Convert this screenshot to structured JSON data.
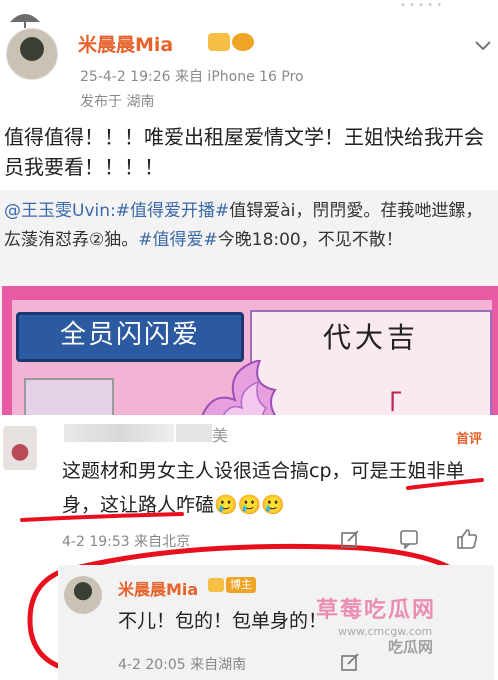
{
  "post": {
    "username": "米晨晨Mia",
    "meta_line1": "25-4-2 19:26  来自 iPhone 16 Pro",
    "meta_line2": "发布于 湖南",
    "text": "值得值得！！！唯爱出租屋爱情文学！王姐快给我开会员我要看！！！！"
  },
  "repost": {
    "mention": "@王玉雯Uvin:",
    "tag1": "#值得爱开播#",
    "text_part1": "值锝爱ài，閅閅愛。荏莪哋迣鏍，厷蔆洧怼孨②㹨。",
    "tag2": "#值得爱#",
    "text_part2": "今晚18:00，不见不散！"
  },
  "poster": {
    "left_label": "全员闪闪爱",
    "right_label": "代大吉",
    "quote_glyph": "「"
  },
  "comment": {
    "name_tail": "美",
    "hot_badge": "首评",
    "text": "这题材和男女主人设很适合搞cp，可是王姐非单身，这让路人咋磕🥲🥲🥲",
    "meta": "4-2 19:53  来自北京"
  },
  "reply": {
    "username": "米晨晨Mia",
    "badge": "博主",
    "text": "不儿！包的！包单身的！",
    "meta": "4-2 20:05  来自湖南"
  },
  "watermark": {
    "main": "草莓吃瓜网",
    "url": "www.cmcgw.com",
    "extra": "吃瓜网"
  },
  "colors": {
    "username": "#e8622c",
    "link": "#3c6aa8",
    "annotation_red": "#e8101c"
  }
}
